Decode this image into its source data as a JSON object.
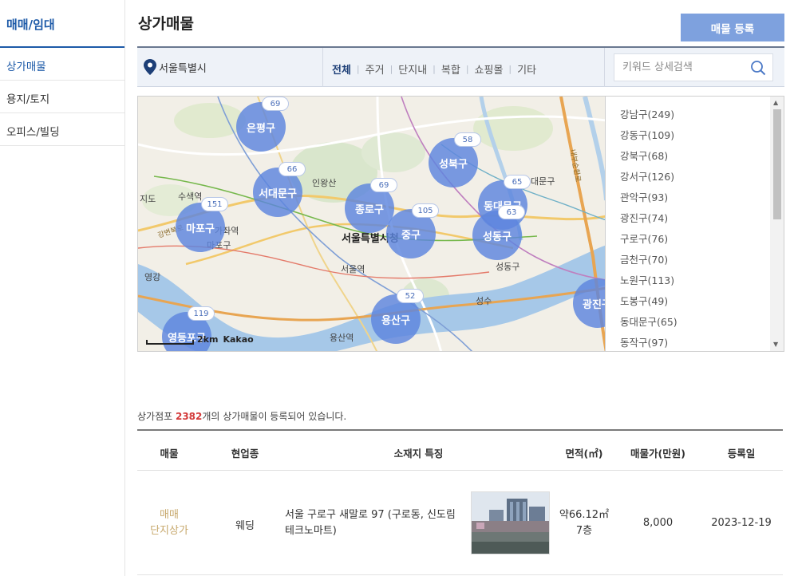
{
  "sidebar": {
    "title": "매매/임대",
    "items": [
      {
        "label": "상가매물"
      },
      {
        "label": "용지/토지"
      },
      {
        "label": "오피스/빌딩"
      }
    ]
  },
  "header": {
    "title": "상가매물",
    "register_label": "매물 등록"
  },
  "filter": {
    "location": "서울특별시",
    "tabs": [
      {
        "label": "전체"
      },
      {
        "label": "주거"
      },
      {
        "label": "단지내"
      },
      {
        "label": "복합"
      },
      {
        "label": "쇼핑몰"
      },
      {
        "label": "기타"
      }
    ],
    "search_placeholder": "키워드 상세검색"
  },
  "map": {
    "clusters": [
      {
        "name": "은평구",
        "count": "69"
      },
      {
        "name": "서대문구",
        "count": "66"
      },
      {
        "name": "마포구",
        "count": "151"
      },
      {
        "name": "종로구",
        "count": "69"
      },
      {
        "name": "중구",
        "count": "105"
      },
      {
        "name": "성북구",
        "count": "58"
      },
      {
        "name": "동대문구",
        "count": "65"
      },
      {
        "name": "성동구",
        "count": "63"
      },
      {
        "name": "용산구",
        "count": "52"
      },
      {
        "name": "영등포구",
        "count": "119"
      },
      {
        "name": "광진구",
        "count": ""
      }
    ],
    "labels": {
      "seoul": "서울특별시청",
      "seoul_station": "서울역",
      "yongsan_station": "용산역",
      "inwangsan": "인왕산",
      "susaek": "수색역",
      "gajwa": "가좌역",
      "jido": "지도",
      "yeonggang": "영강",
      "seongdong": "성동구",
      "seongsu": "성수",
      "dongdaemun_label": "대문구",
      "river": "강변북로",
      "naebu": "내부순환로",
      "mapogu_small": "마포구"
    },
    "scale": "2km",
    "brand": "Kakao"
  },
  "districts": [
    "강남구(249)",
    "강동구(109)",
    "강북구(68)",
    "강서구(126)",
    "관악구(93)",
    "광진구(74)",
    "구로구(76)",
    "금천구(70)",
    "노원구(113)",
    "도봉구(49)",
    "동대문구(65)",
    "동작구(97)"
  ],
  "summary": {
    "prefix": "상가점포 ",
    "count": "2382",
    "suffix": "개의 상가매물이 등록되어 있습니다."
  },
  "table": {
    "headers": [
      "매물",
      "현업종",
      "소재지 특징",
      "면적(㎡)",
      "매물가(만원)",
      "등록일"
    ],
    "rows": [
      {
        "type_line1": "매매",
        "type_line2": "단지상가",
        "business": "웨딩",
        "address": "서울 구로구 새말로 97 (구로동, 신도림 테크노마트)",
        "area": "약66.12㎡",
        "floor": "7층",
        "price": "8,000",
        "date": "2023-12-19"
      }
    ]
  },
  "colors": {
    "brand_blue": "#1d5aa8",
    "button_blue": "#7ea1de",
    "cluster_blue": "#5d85de",
    "count_red": "#d33a3a",
    "type_gold": "#c7a86c"
  }
}
